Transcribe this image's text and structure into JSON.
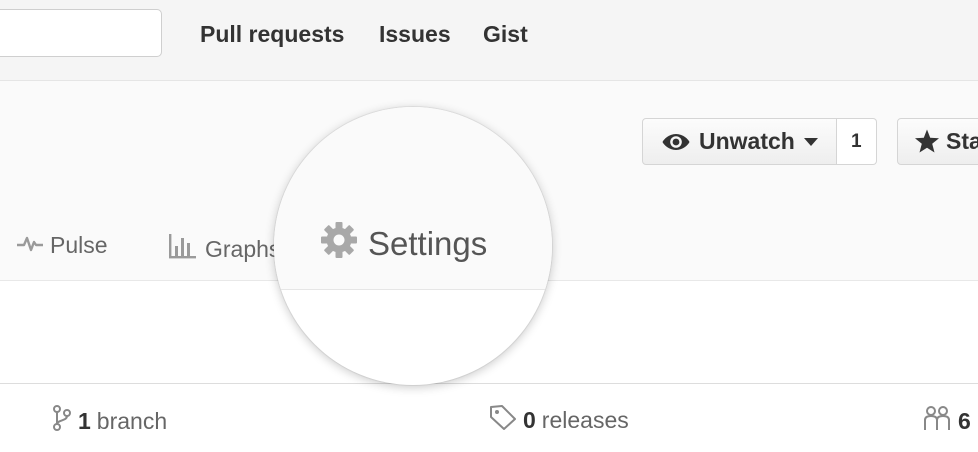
{
  "header": {
    "search": {
      "value": "",
      "placeholder": ""
    },
    "nav": [
      "Pull requests",
      "Issues",
      "Gist"
    ]
  },
  "actions": {
    "watch": {
      "label": "Unwatch",
      "count": "1",
      "icon": "eye-icon"
    },
    "star": {
      "label": "Sta",
      "icon": "star-icon"
    }
  },
  "tabs": {
    "pulse": {
      "label": "Pulse",
      "icon": "pulse-icon"
    },
    "graphs": {
      "label": "Graphs",
      "icon": "graph-icon"
    },
    "settings": {
      "label": "Settings",
      "icon": "gear-icon"
    }
  },
  "summary": {
    "branches": {
      "count": "1",
      "label": "branch",
      "icon": "branch-icon"
    },
    "releases": {
      "count": "0",
      "label": "releases",
      "icon": "tag-icon"
    },
    "contributors": {
      "count": "6",
      "label": "",
      "icon": "contributors-icon"
    }
  },
  "colors": {
    "header_bg": "#f5f5f5",
    "repohead_bg": "#fafafa",
    "text_dark": "#333333",
    "text_muted": "#666666"
  }
}
